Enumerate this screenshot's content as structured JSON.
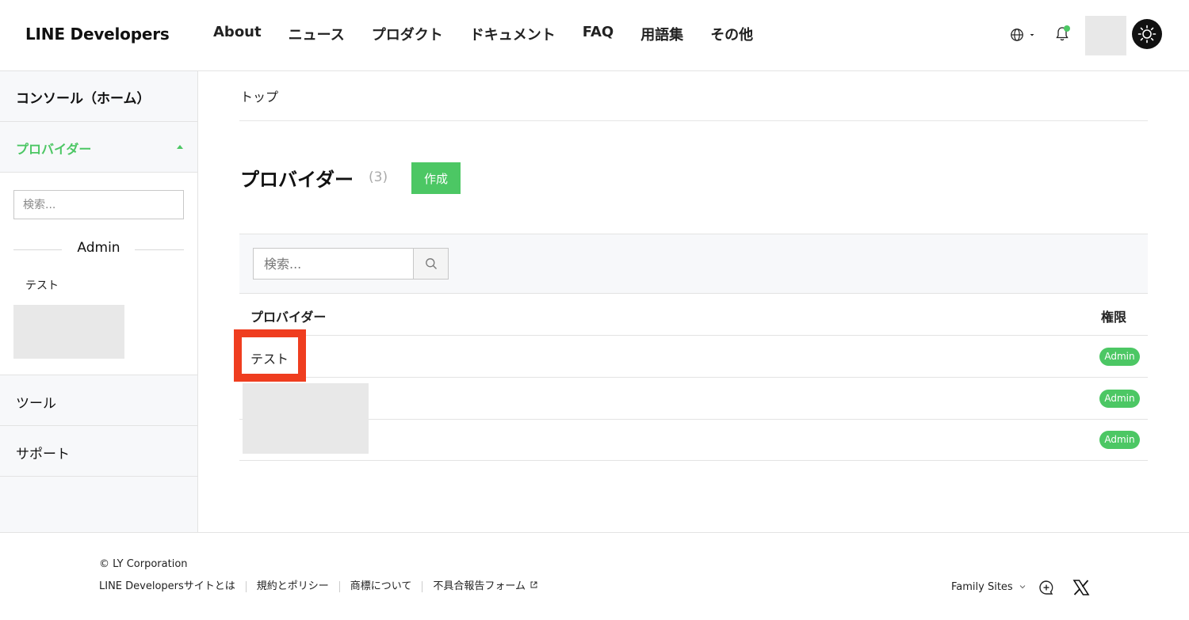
{
  "header": {
    "logo": "LINE Developers",
    "nav": [
      "About",
      "ニュース",
      "プロダクト",
      "ドキュメント",
      "FAQ",
      "用語集",
      "その他"
    ]
  },
  "sidebar": {
    "home": "コンソール（ホーム）",
    "provider": "プロバイダー",
    "search_placeholder": "検索...",
    "group_label": "Admin",
    "items": [
      "テスト"
    ],
    "tools": "ツール",
    "support": "サポート"
  },
  "main": {
    "breadcrumb": "トップ",
    "title": "プロバイダー",
    "count": "(3)",
    "create_label": "作成",
    "search_placeholder": "検索...",
    "table": {
      "headers": [
        "プロバイダー",
        "権限"
      ],
      "rows": [
        {
          "name": "テスト",
          "role": "Admin"
        },
        {
          "name": "",
          "role": "Admin"
        },
        {
          "name": "",
          "role": "Admin"
        }
      ]
    }
  },
  "footer": {
    "copyright": "© LY Corporation",
    "links": [
      "LINE Developersサイトとは",
      "規約とポリシー",
      "商標について",
      "不具合報告フォーム"
    ],
    "family_sites": "Family Sites"
  },
  "colors": {
    "accent": "#4cc764",
    "highlight": "#ef3d1f"
  }
}
